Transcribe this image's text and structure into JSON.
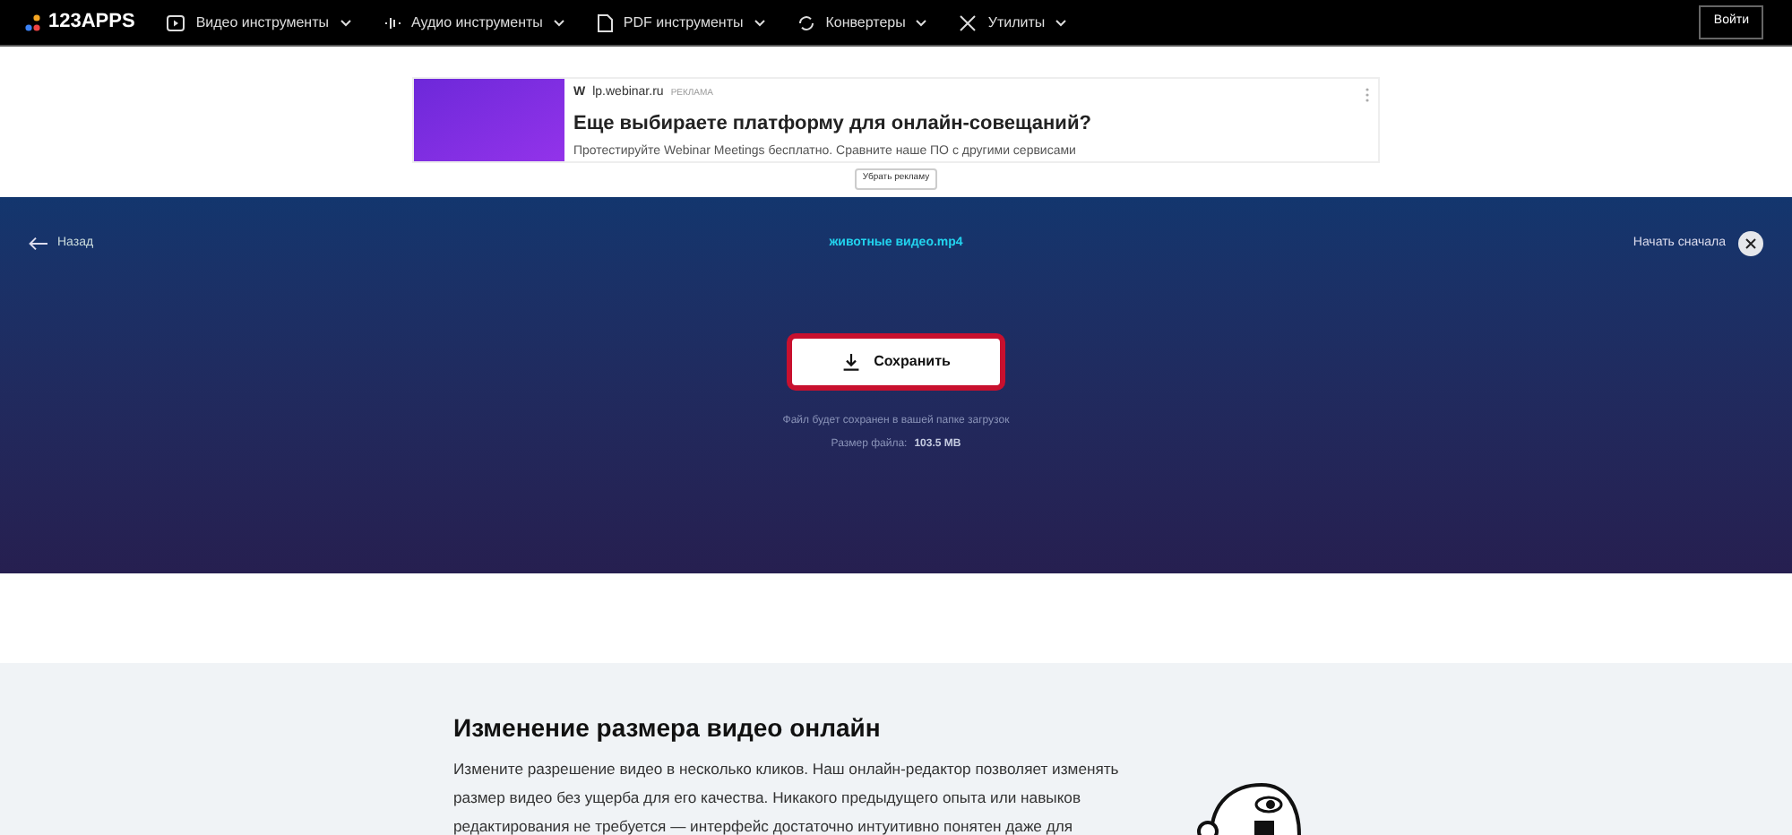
{
  "nav": {
    "logo": "123APPS",
    "menu": [
      {
        "label": "Видео инструменты"
      },
      {
        "label": "Аудио инструменты"
      },
      {
        "label": "PDF инструменты"
      },
      {
        "label": "Конвертеры"
      },
      {
        "label": "Утилиты"
      }
    ],
    "login": "Войти"
  },
  "ad": {
    "favicon": "W",
    "domain": "lp.webinar.ru",
    "tag": "РЕКЛАМА",
    "title": "Еще выбираете платформу для онлайн-совещаний?",
    "text": "Протестируйте Webinar Meetings бесплатно. Сравните наше ПО с другими сервисами",
    "remove": "Убрать рекламу"
  },
  "editor": {
    "back": "Назад",
    "filename": "животные видео.mp4",
    "restart": "Начать сначала",
    "save": "Сохранить",
    "note": "Файл будет сохранен в вашей папке загрузок",
    "size_label": "Размер файла:",
    "size": "103.5 MB"
  },
  "article": {
    "heading": "Изменение размера видео онлайн",
    "paragraph": "Измените разрешение видео в несколько кликов. Наш онлайн-редактор позволяет изменять размер видео без ущерба для его качества. Никакого предыдущего опыта или навыков редактирования не требуется — интерфейс достаточно интуитивно понятен даже для"
  }
}
